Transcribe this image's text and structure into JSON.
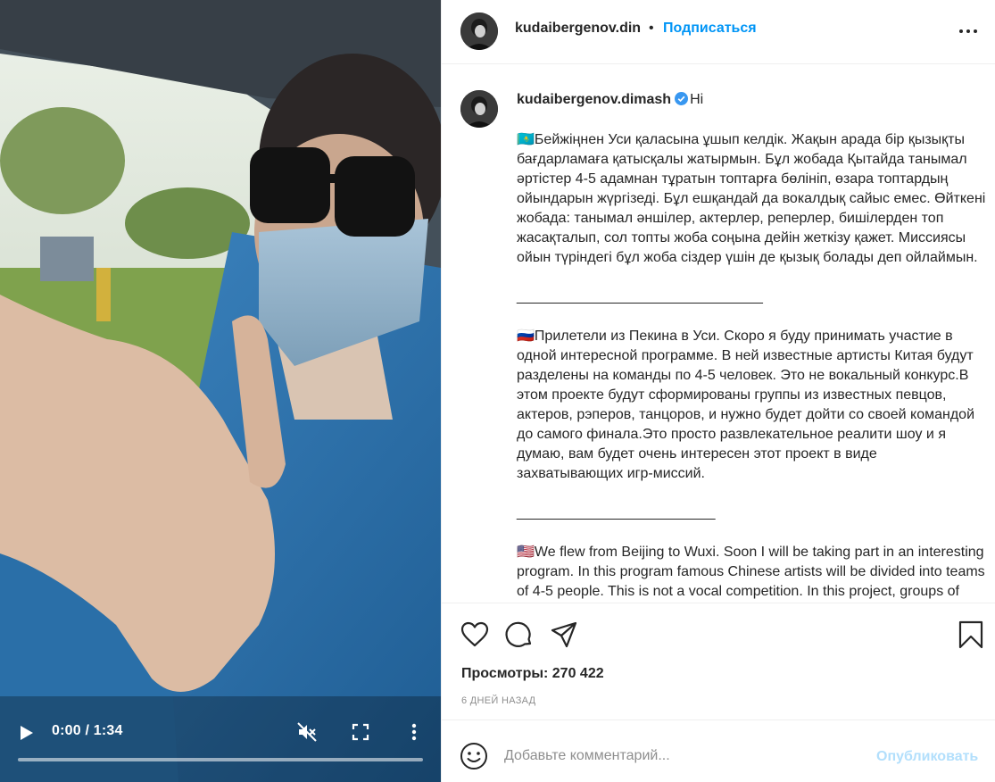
{
  "video": {
    "time": "0:00 / 1:34",
    "progress": 0
  },
  "header": {
    "username": "kudaibergenov.din",
    "separator": "•",
    "follow_label": "Подписаться"
  },
  "caption": {
    "author": "kudaibergenov.dimash",
    "greeting": "Hi",
    "kz_text": "🇰🇿Бейжіңнен Уси қаласына ұшып келдік. Жақын арада бір қызықты бағдарламаға қатысқалы жатырмын. Бұл жобада Қытайда танымал әртістер 4-5 адамнан тұратын топтарға бөлініп, өзара топтардың ойындарын жүргізеді. Бұл ешқандай да вокалдық сайыс емес. Өйткені жобада: танымал әншілер, актерлер, реперлер, бишілерден топ жасақталып, сол топты жоба соңына дейін жеткізу қажет. Миссиясы ойын түріндегі бұл жоба сіздер үшін де қызық болады деп ойлаймын.",
    "separator_1": "_______________________________",
    "ru_text": "🇷🇺Прилетели из Пекина в Уси. Скоро я буду принимать участие в одной интересной программе. В ней известные артисты Китая будут разделены на команды по 4-5 человек. Это не вокальный конкурс.В этом проекте будут сформированы группы из известных певцов, актеров, рэперов, танцоров, и нужно будет дойти со своей командой до самого финала.Это просто развлекательное реалити шоу и я думаю, вам будет очень интересен этот проект в виде захватывающих игр-миссий.",
    "separator_2": "_________________________",
    "en_text": "🇺🇸We flew from Beijing to Wuxi. Soon I will be taking part in an interesting program. In this program famous Chinese artists will be divided into teams of 4-5 people. This is not a vocal competition. In this project, groups of famous singers, actors, rappers, dancers will"
  },
  "stats": {
    "views": "Просмотры: 270 422",
    "date": "6 ДНЕЙ НАЗАД"
  },
  "comment": {
    "placeholder": "Добавьте комментарий...",
    "post_label": "Опубликовать"
  },
  "colors": {
    "accent": "#0095f6",
    "post_disabled": "#b2dffc",
    "text": "#262626",
    "muted": "#8e8e8e",
    "border": "#efefef"
  },
  "icons": [
    "play-icon",
    "mute-icon",
    "fullscreen-icon",
    "more-vertical-icon",
    "more-horizontal-icon",
    "verified-icon",
    "heart-icon",
    "comment-icon",
    "share-icon",
    "bookmark-icon",
    "emoji-icon"
  ]
}
